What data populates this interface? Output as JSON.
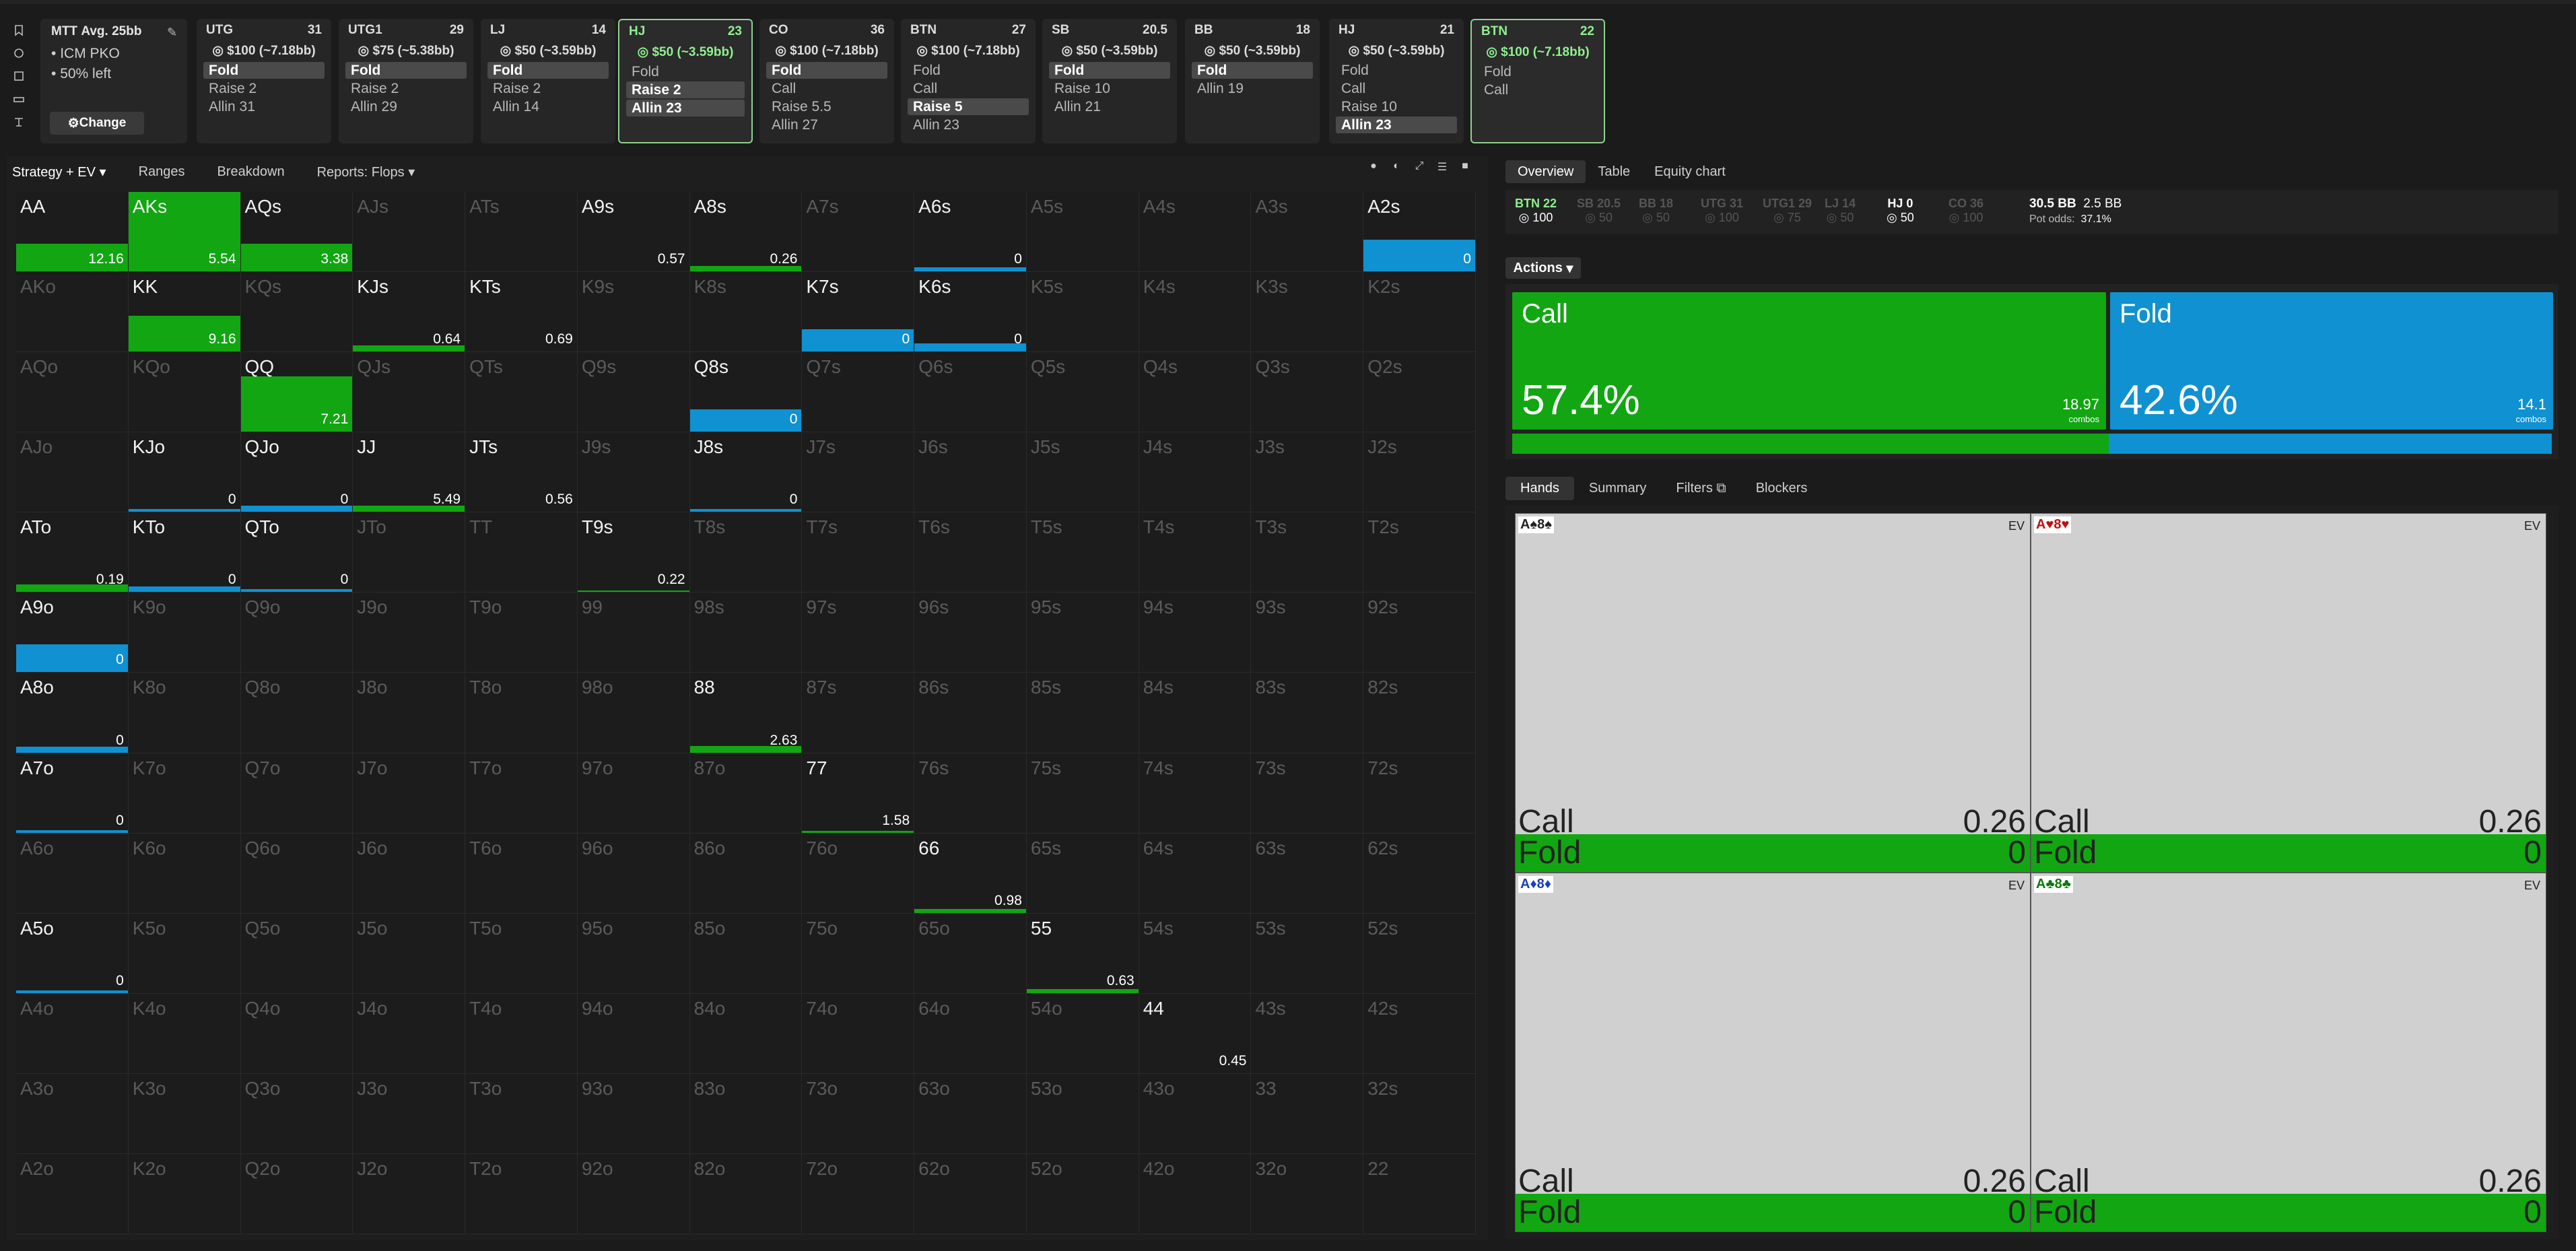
{
  "colors": {
    "call": "#12a612",
    "fold": "#1091d1",
    "active_border": "#8fd18f"
  },
  "tournament": {
    "title": "MTT",
    "avg": "Avg. 25bb",
    "bullets": [
      "ICM PKO",
      "50% left"
    ],
    "change_label": "Change"
  },
  "positions": [
    {
      "pos": "UTG",
      "stack": "31",
      "money": "$100 (~7.18bb)",
      "active": false,
      "actions": [
        {
          "label": "Fold",
          "sel": true
        },
        {
          "label": "Raise 2",
          "sel": false
        },
        {
          "label": "Allin 31",
          "sel": false
        }
      ]
    },
    {
      "pos": "UTG1",
      "stack": "29",
      "money": "$75 (~5.38bb)",
      "active": false,
      "actions": [
        {
          "label": "Fold",
          "sel": true
        },
        {
          "label": "Raise 2",
          "sel": false
        },
        {
          "label": "Allin 29",
          "sel": false
        }
      ]
    },
    {
      "pos": "LJ",
      "stack": "14",
      "money": "$50 (~3.59bb)",
      "active": false,
      "actions": [
        {
          "label": "Fold",
          "sel": true
        },
        {
          "label": "Raise 2",
          "sel": false
        },
        {
          "label": "Allin 14",
          "sel": false
        }
      ]
    },
    {
      "pos": "HJ",
      "stack": "23",
      "money": "$50 (~3.59bb)",
      "active": true,
      "actions": [
        {
          "label": "Fold",
          "sel": false
        },
        {
          "label": "Raise 2",
          "sel": true
        },
        {
          "label": "Allin 23",
          "sel": true
        }
      ]
    },
    {
      "pos": "CO",
      "stack": "36",
      "money": "$100 (~7.18bb)",
      "active": false,
      "actions": [
        {
          "label": "Fold",
          "sel": true
        },
        {
          "label": "Call",
          "sel": false
        },
        {
          "label": "Raise 5.5",
          "sel": false
        },
        {
          "label": "Allin 27",
          "sel": false
        }
      ]
    },
    {
      "pos": "BTN",
      "stack": "27",
      "money": "$100 (~7.18bb)",
      "active": false,
      "actions": [
        {
          "label": "Fold",
          "sel": false
        },
        {
          "label": "Call",
          "sel": false
        },
        {
          "label": "Raise 5",
          "sel": true
        },
        {
          "label": "Allin 23",
          "sel": false
        }
      ]
    },
    {
      "pos": "SB",
      "stack": "20.5",
      "money": "$50 (~3.59bb)",
      "active": false,
      "actions": [
        {
          "label": "Fold",
          "sel": true
        },
        {
          "label": "Raise 10",
          "sel": false
        },
        {
          "label": "Allin 21",
          "sel": false
        }
      ]
    },
    {
      "pos": "BB",
      "stack": "18",
      "money": "$50 (~3.59bb)",
      "active": false,
      "actions": [
        {
          "label": "Fold",
          "sel": true
        },
        {
          "label": "Allin 19",
          "sel": false
        }
      ]
    },
    {
      "pos": "HJ",
      "stack": "21",
      "money": "$50 (~3.59bb)",
      "active": false,
      "actions": [
        {
          "label": "Fold",
          "sel": false
        },
        {
          "label": "Call",
          "sel": false
        },
        {
          "label": "Raise 10",
          "sel": false
        },
        {
          "label": "Allin 23",
          "sel": true
        }
      ]
    },
    {
      "pos": "BTN",
      "stack": "22",
      "money": "$100 (~7.18bb)",
      "active": true,
      "actions": [
        {
          "label": "Fold",
          "sel": false
        },
        {
          "label": "Call",
          "sel": false
        }
      ]
    }
  ],
  "grid_tabs": [
    "Strategy + EV",
    "Ranges",
    "Breakdown",
    "Reports: Flops"
  ],
  "grid": [
    [
      "AA",
      "AKs",
      "AQs",
      "AJs",
      "ATs",
      "A9s",
      "A8s",
      "A7s",
      "A6s",
      "A5s",
      "A4s",
      "A3s",
      "A2s"
    ],
    [
      "AKo",
      "KK",
      "KQs",
      "KJs",
      "KTs",
      "K9s",
      "K8s",
      "K7s",
      "K6s",
      "K5s",
      "K4s",
      "K3s",
      "K2s"
    ],
    [
      "AQo",
      "KQo",
      "QQ",
      "QJs",
      "QTs",
      "Q9s",
      "Q8s",
      "Q7s",
      "Q6s",
      "Q5s",
      "Q4s",
      "Q3s",
      "Q2s"
    ],
    [
      "AJo",
      "KJo",
      "QJo",
      "JJ",
      "JTs",
      "J9s",
      "J8s",
      "J7s",
      "J6s",
      "J5s",
      "J4s",
      "J3s",
      "J2s"
    ],
    [
      "ATo",
      "KTo",
      "QTo",
      "JTo",
      "TT",
      "T9s",
      "T8s",
      "T7s",
      "T6s",
      "T5s",
      "T4s",
      "T3s",
      "T2s"
    ],
    [
      "A9o",
      "K9o",
      "Q9o",
      "J9o",
      "T9o",
      "99",
      "98s",
      "97s",
      "96s",
      "95s",
      "94s",
      "93s",
      "92s"
    ],
    [
      "A8o",
      "K8o",
      "Q8o",
      "J8o",
      "T8o",
      "98o",
      "88",
      "87s",
      "86s",
      "85s",
      "84s",
      "83s",
      "82s"
    ],
    [
      "A7o",
      "K7o",
      "Q7o",
      "J7o",
      "T7o",
      "97o",
      "87o",
      "77",
      "76s",
      "75s",
      "74s",
      "73s",
      "72s"
    ],
    [
      "A6o",
      "K6o",
      "Q6o",
      "J6o",
      "T6o",
      "96o",
      "86o",
      "76o",
      "66",
      "65s",
      "64s",
      "63s",
      "62s"
    ],
    [
      "A5o",
      "K5o",
      "Q5o",
      "J5o",
      "T5o",
      "95o",
      "85o",
      "75o",
      "65o",
      "55",
      "54s",
      "53s",
      "52s"
    ],
    [
      "A4o",
      "K4o",
      "Q4o",
      "J4o",
      "T4o",
      "94o",
      "84o",
      "74o",
      "64o",
      "54o",
      "44",
      "43s",
      "42s"
    ],
    [
      "A3o",
      "K3o",
      "Q3o",
      "J3o",
      "T3o",
      "93o",
      "83o",
      "73o",
      "63o",
      "53o",
      "43o",
      "33",
      "32s"
    ],
    [
      "A2o",
      "K2o",
      "Q2o",
      "J2o",
      "T2o",
      "92o",
      "82o",
      "72o",
      "62o",
      "52o",
      "42o",
      "32o",
      "22"
    ]
  ],
  "hand_stats": {
    "AA": {
      "call": 1.0,
      "fold": 0.0,
      "w": 1.0,
      "h": 0.35,
      "ev": "12.16"
    },
    "AKs": {
      "call": 1.0,
      "fold": 0.0,
      "w": 1.0,
      "h": 1.0,
      "ev": "5.54"
    },
    "AQs": {
      "call": 1.0,
      "fold": 0.0,
      "w": 1.0,
      "h": 0.35,
      "ev": "3.38"
    },
    "A9s": {
      "call": 0,
      "fold": 0,
      "w": 0,
      "h": 0,
      "ev": "0.57"
    },
    "A8s": {
      "call": 1.0,
      "fold": 0.0,
      "w": 1.0,
      "h": 0.07,
      "ev": "0.26"
    },
    "A6s": {
      "call": 0.0,
      "fold": 1.0,
      "w": 1.0,
      "h": 0.05,
      "ev": "0"
    },
    "A2s": {
      "call": 0.0,
      "fold": 1.0,
      "w": 1.0,
      "h": 0.4,
      "ev": "0"
    },
    "KK": {
      "call": 1.0,
      "fold": 0.0,
      "w": 1.0,
      "h": 0.45,
      "ev": "9.16"
    },
    "KJs": {
      "call": 1.0,
      "fold": 0.0,
      "w": 1.0,
      "h": 0.08,
      "ev": "0.64"
    },
    "KTs": {
      "call": 0,
      "fold": 0,
      "w": 0,
      "h": 0,
      "ev": "0.69"
    },
    "K7s": {
      "call": 0.0,
      "fold": 1.0,
      "w": 1.0,
      "h": 0.28,
      "ev": "0"
    },
    "K6s": {
      "call": 0.0,
      "fold": 1.0,
      "w": 1.0,
      "h": 0.1,
      "ev": "0"
    },
    "QQ": {
      "call": 1.0,
      "fold": 0.0,
      "w": 1.0,
      "h": 0.7,
      "ev": "7.21"
    },
    "Q8s": {
      "call": 0.0,
      "fold": 1.0,
      "w": 1.0,
      "h": 0.28,
      "ev": "0"
    },
    "KJo": {
      "call": 0.0,
      "fold": 1.0,
      "w": 1.0,
      "h": 0.04,
      "ev": "0"
    },
    "QJo": {
      "call": 0.0,
      "fold": 1.0,
      "w": 1.0,
      "h": 0.08,
      "ev": "0"
    },
    "JJ": {
      "call": 1.0,
      "fold": 0.0,
      "w": 1.0,
      "h": 0.08,
      "ev": "5.49"
    },
    "JTs": {
      "call": 0,
      "fold": 0,
      "w": 0,
      "h": 0,
      "ev": "0.56"
    },
    "J8s": {
      "call": 0.0,
      "fold": 1.0,
      "w": 1.0,
      "h": 0.04,
      "ev": "0"
    },
    "ATo": {
      "call": 1.0,
      "fold": 0.0,
      "w": 1.0,
      "h": 0.1,
      "ev": "0.19"
    },
    "KTo": {
      "call": 0.0,
      "fold": 1.0,
      "w": 1.0,
      "h": 0.07,
      "ev": "0"
    },
    "QTo": {
      "call": 0.0,
      "fold": 1.0,
      "w": 1.0,
      "h": 0.04,
      "ev": "0"
    },
    "T9s": {
      "call": 1.0,
      "fold": 0.0,
      "w": 1.0,
      "h": 0.02,
      "ev": "0.22"
    },
    "A9o": {
      "call": 0.0,
      "fold": 1.0,
      "w": 1.0,
      "h": 0.35,
      "ev": "0"
    },
    "A8o": {
      "call": 0.0,
      "fold": 1.0,
      "w": 1.0,
      "h": 0.07,
      "ev": "0"
    },
    "88": {
      "call": 1.0,
      "fold": 0.0,
      "w": 1.0,
      "h": 0.08,
      "ev": "2.63"
    },
    "A7o": {
      "call": 0.0,
      "fold": 1.0,
      "w": 1.0,
      "h": 0.03,
      "ev": "0"
    },
    "77": {
      "call": 1.0,
      "fold": 0.0,
      "w": 1.0,
      "h": 0.02,
      "ev": "1.58"
    },
    "66": {
      "call": 1.0,
      "fold": 0.0,
      "w": 1.0,
      "h": 0.05,
      "ev": "0.98"
    },
    "A5o": {
      "call": 0.0,
      "fold": 1.0,
      "w": 1.0,
      "h": 0.03,
      "ev": "0"
    },
    "55": {
      "call": 1.0,
      "fold": 0.0,
      "w": 1.0,
      "h": 0.05,
      "ev": "0.63"
    },
    "44": {
      "call": 0,
      "fold": 0,
      "w": 0,
      "h": 0,
      "ev": "0.45"
    }
  },
  "active_hands": [
    "AA",
    "AKs",
    "AQs",
    "A9s",
    "A8s",
    "A6s",
    "A2s",
    "KK",
    "KJs",
    "KTs",
    "K7s",
    "K6s",
    "QQ",
    "Q8s",
    "KJo",
    "QJo",
    "JJ",
    "JTs",
    "J8s",
    "ATo",
    "KTo",
    "QTo",
    "T9s",
    "A9o",
    "A8o",
    "88",
    "A7o",
    "77",
    "66",
    "A5o",
    "55",
    "44"
  ],
  "grid_icons": [
    "palette-icon",
    "contrast-icon",
    "expand-icon",
    "list-icon",
    "square-icon"
  ],
  "right_tabs": [
    "Overview",
    "Table",
    "Equity chart"
  ],
  "stacks": [
    {
      "name": "BTN 22",
      "val": "100",
      "on": true,
      "btn": true
    },
    {
      "name": "SB 20.5",
      "val": "50",
      "on": false
    },
    {
      "name": "BB 18",
      "val": "50",
      "on": false
    },
    {
      "name": "UTG 31",
      "val": "100",
      "on": false
    },
    {
      "name": "UTG1 29",
      "val": "75",
      "on": false
    },
    {
      "name": "LJ 14",
      "val": "50",
      "on": false
    },
    {
      "name": "HJ 0",
      "val": "50",
      "on": true
    },
    {
      "name": "CO 36",
      "val": "100",
      "on": false
    }
  ],
  "pot": {
    "main": "30.5 BB",
    "side": "2.5 BB",
    "odds_label": "Pot odds:",
    "odds": "37.1%"
  },
  "actions_label": "Actions",
  "actions": [
    {
      "name": "Call",
      "pct": "57.4%",
      "combos": "18.97",
      "combos_label": "combos",
      "frac": 0.574,
      "color": "#12a612"
    },
    {
      "name": "Fold",
      "pct": "42.6%",
      "combos": "14.1",
      "combos_label": "combos",
      "frac": 0.426,
      "color": "#1091d1"
    }
  ],
  "hand_tabs": [
    "Hands",
    "Summary",
    "Filters",
    "Blockers"
  ],
  "hand_cards": [
    {
      "r1": "A",
      "s1": "♠",
      "c1": "",
      "r2": "8",
      "s2": "♠",
      "c2": "",
      "ev_label": "EV",
      "call": "Call",
      "call_ev": "0.26",
      "fold": "Fold",
      "fold_ev": "0"
    },
    {
      "r1": "A",
      "s1": "♥",
      "c1": "red",
      "r2": "8",
      "s2": "♥",
      "c2": "red",
      "ev_label": "EV",
      "call": "Call",
      "call_ev": "0.26",
      "fold": "Fold",
      "fold_ev": "0"
    },
    {
      "r1": "A",
      "s1": "♦",
      "c1": "blu",
      "r2": "8",
      "s2": "♦",
      "c2": "blu",
      "ev_label": "EV",
      "call": "Call",
      "call_ev": "0.26",
      "fold": "Fold",
      "fold_ev": "0"
    },
    {
      "r1": "A",
      "s1": "♣",
      "c1": "grn",
      "r2": "8",
      "s2": "♣",
      "c2": "grn",
      "ev_label": "EV",
      "call": "Call",
      "call_ev": "0.26",
      "fold": "Fold",
      "fold_ev": "0"
    }
  ]
}
